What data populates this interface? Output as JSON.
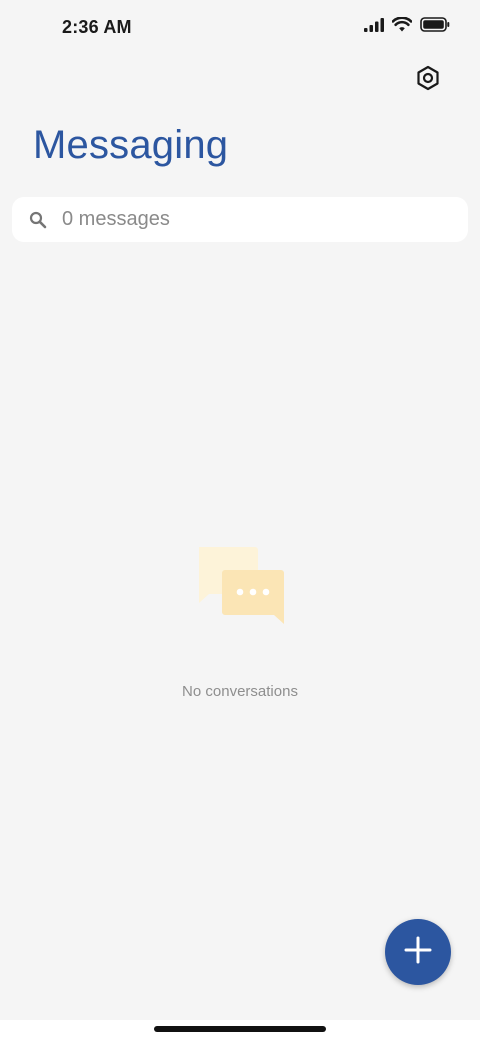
{
  "status_bar": {
    "time": "2:36 AM",
    "icons": [
      "signal-icon",
      "wifi-icon",
      "battery-icon"
    ]
  },
  "header": {
    "settings_icon": "settings-hexagon-icon",
    "title": "Messaging"
  },
  "search": {
    "icon": "search-icon",
    "text": "0 messages"
  },
  "empty_state": {
    "icon": "chat-bubbles-icon",
    "text": "No conversations"
  },
  "fab": {
    "icon": "plus-icon"
  },
  "colors": {
    "accent": "#2c56a0",
    "background": "#f5f5f5",
    "illustration_back": "#fdf3d9",
    "illustration_front": "#fbe5b5"
  }
}
